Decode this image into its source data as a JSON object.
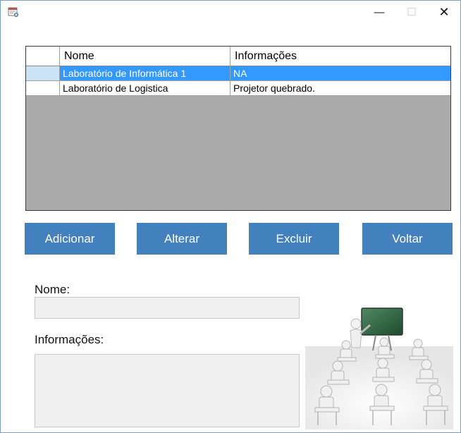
{
  "window": {
    "icon": "calendar-settings-icon",
    "minimize_glyph": "—",
    "maximize_glyph": "☐",
    "close_glyph": "✕"
  },
  "grid": {
    "columns": [
      "Nome",
      "Informações"
    ],
    "rows": [
      {
        "nome": "Laboratório de Informática 1",
        "info": "NA",
        "selected": true
      },
      {
        "nome": "Laboratório de Logistica",
        "info": "Projetor quebrado.",
        "selected": false
      }
    ],
    "selection_color": "#3399ff",
    "background_color": "#ababab"
  },
  "buttons": {
    "adicionar": "Adicionar",
    "alterar": "Alterar",
    "excluir": "Excluir",
    "voltar": "Voltar",
    "color": "#4281bd"
  },
  "form": {
    "nome_label": "Nome:",
    "nome_value": "",
    "informacoes_label": "Informações:",
    "informacoes_value": ""
  },
  "illustration": {
    "icon": "classroom-illustration-icon"
  }
}
